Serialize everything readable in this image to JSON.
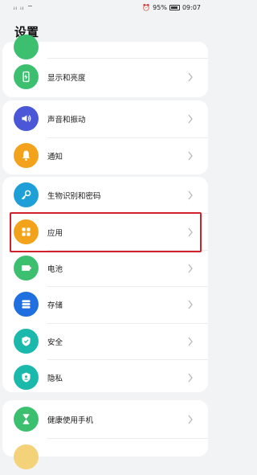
{
  "status_bar": {
    "left": "ᵢₗ ᵢₗ ⌔",
    "battery_percent": "95%",
    "time": "09:07"
  },
  "page_title": "设置",
  "items": [
    {
      "label": "",
      "color": "#3cc070",
      "icon": "partial-icon"
    },
    {
      "label": "显示和亮度",
      "color": "#3cc070",
      "icon": "display-brightness-icon"
    },
    {
      "label": "声音和振动",
      "color": "#4a57d6",
      "icon": "sound-icon"
    },
    {
      "label": "通知",
      "color": "#f2a31b",
      "icon": "bell-icon"
    },
    {
      "label": "生物识别和密码",
      "color": "#1e9fd8",
      "icon": "key-icon"
    },
    {
      "label": "应用",
      "color": "#f2a31b",
      "icon": "apps-icon"
    },
    {
      "label": "电池",
      "color": "#3cc070",
      "icon": "battery-icon"
    },
    {
      "label": "存储",
      "color": "#1f6fe0",
      "icon": "storage-icon"
    },
    {
      "label": "安全",
      "color": "#1ab9ac",
      "icon": "shield-icon"
    },
    {
      "label": "隐私",
      "color": "#1ab9ac",
      "icon": "privacy-icon"
    },
    {
      "label": "健康使用手机",
      "color": "#3cc070",
      "icon": "hourglass-icon"
    }
  ],
  "highlight_color": "#d0202a"
}
